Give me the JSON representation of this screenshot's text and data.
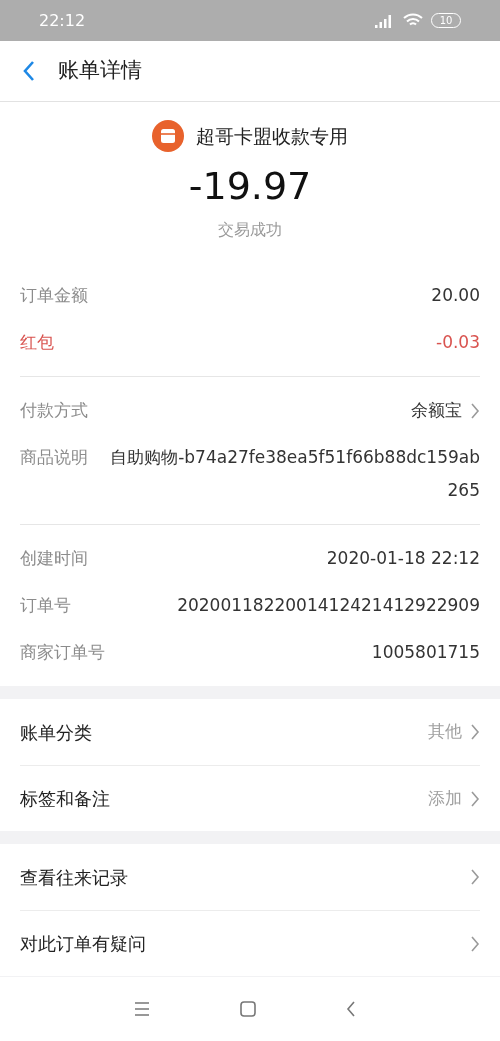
{
  "status_bar": {
    "time": "22:12",
    "battery": "10"
  },
  "header": {
    "title": "账单详情"
  },
  "summary": {
    "merchant": "超哥卡盟收款专用",
    "amount": "-19.97",
    "status": "交易成功"
  },
  "detail_groups": [
    {
      "rows": [
        {
          "kind": "plain",
          "label": "订单金额",
          "value": "20.00"
        },
        {
          "kind": "discount",
          "label": "红包",
          "value": "-0.03"
        }
      ]
    },
    {
      "rows": [
        {
          "kind": "link",
          "label": "付款方式",
          "value": "余额宝"
        },
        {
          "kind": "plain",
          "label": "商品说明",
          "value": "自助购物-b74a27fe38ea5f51f66b88dc159ab265"
        }
      ]
    },
    {
      "rows": [
        {
          "kind": "plain",
          "label": "创建时间",
          "value": "2020-01-18 22:12"
        },
        {
          "kind": "plain",
          "label": "订单号",
          "value": "2020011822001412421412922909"
        },
        {
          "kind": "plain",
          "label": "商家订单号",
          "value": "1005801715"
        }
      ]
    }
  ],
  "menu_sections": [
    {
      "items": [
        {
          "label": "账单分类",
          "value": "其他"
        },
        {
          "label": "标签和备注",
          "value": "添加"
        }
      ]
    },
    {
      "items": [
        {
          "label": "查看往来记录"
        },
        {
          "label": "对此订单有疑问"
        }
      ]
    }
  ]
}
